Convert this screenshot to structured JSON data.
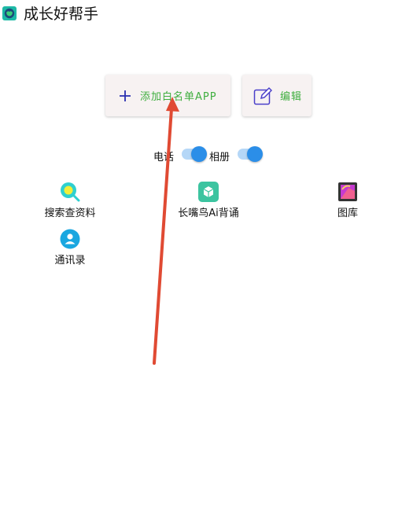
{
  "header": {
    "title": "成长好帮手",
    "icon": "app-logo-icon"
  },
  "toolbar": {
    "add_label": "添加白名单APP",
    "edit_label": "编辑",
    "accent_color": "#3fae3f"
  },
  "toggles": [
    {
      "label": "电话",
      "on": true
    },
    {
      "label": "相册",
      "on": true
    }
  ],
  "apps": [
    {
      "name": "搜索查资料",
      "icon": "search-app-icon"
    },
    {
      "name": "长嘴鸟Ai背诵",
      "icon": "cube-app-icon"
    },
    {
      "name": "图库",
      "icon": "gallery-app-icon"
    },
    {
      "name": "通讯录",
      "icon": "contacts-app-icon"
    }
  ],
  "annotation": {
    "color": "#e04a33"
  }
}
